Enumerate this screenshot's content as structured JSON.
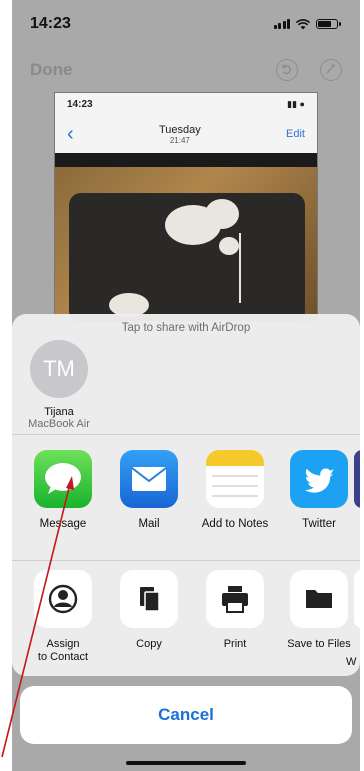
{
  "status": {
    "time": "14:23"
  },
  "editbar": {
    "done": "Done"
  },
  "preview": {
    "time": "14:23",
    "title": "Tuesday",
    "subtitle": "21:47",
    "edit": "Edit"
  },
  "sheet": {
    "airdrop_hint": "Tap to share with AirDrop",
    "device": {
      "initials": "TM",
      "name": "Tijana",
      "model": "MacBook Air"
    },
    "apps": [
      {
        "label": "Message",
        "icon": "messages-icon"
      },
      {
        "label": "Mail",
        "icon": "mail-icon"
      },
      {
        "label": "Add to Notes",
        "icon": "notes-icon"
      },
      {
        "label": "Twitter",
        "icon": "twitter-icon"
      }
    ],
    "actions": [
      {
        "label_line1": "Assign",
        "label_line2": "to Contact",
        "icon": "contact-icon"
      },
      {
        "label": "Copy",
        "icon": "copy-icon"
      },
      {
        "label": "Print",
        "icon": "print-icon"
      },
      {
        "label": "Save to Files",
        "icon": "folder-icon"
      },
      {
        "label": "W",
        "icon": "partial-icon"
      }
    ],
    "cancel": "Cancel"
  },
  "colors": {
    "accent": "#1a70d9",
    "annotation_arrow": "#c4161c"
  }
}
